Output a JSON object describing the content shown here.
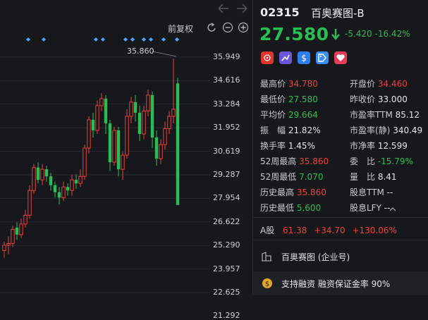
{
  "chart": {
    "restoration_label": "前复权",
    "y_ticks": [
      "35.949",
      "34.616",
      "33.284",
      "31.952",
      "30.619",
      "29.287",
      "27.954",
      "26.622",
      "25.290",
      "23.957",
      "22.625",
      "21.292"
    ],
    "peak_label": "35.860",
    "colors": {
      "up": "#ee3f3f",
      "down": "#2bbd55",
      "marker": "#4da3ff"
    }
  },
  "quote": {
    "code": "02315",
    "name": "百奥赛图-B",
    "price": "27.580",
    "change": "-5.420",
    "change_pct": "-16.42%",
    "stats": {
      "high_label": "最高价",
      "high": "34.780",
      "open_label": "开盘价",
      "open": "34.460",
      "low_label": "最低价",
      "low": "27.580",
      "prev_close_label": "昨收价",
      "prev_close": "33.000",
      "avg_label": "平均价",
      "avg": "29.664",
      "pe_ttm_label": "市盈率TTM",
      "pe_ttm": "85.12",
      "amplitude_label": "振　幅",
      "amplitude": "21.82%",
      "pe_static_label": "市盈率(静)",
      "pe_static": "340.49",
      "turnover_label": "换手率",
      "turnover": "1.45%",
      "pb_label": "市净率",
      "pb": "12.599",
      "w52_high_label": "52周最高",
      "w52_high": "35.860",
      "commission_label": "委　比",
      "commission": "-15.79%",
      "w52_low_label": "52周最低",
      "w52_low": "7.070",
      "volume_ratio_label": "量　比",
      "volume_ratio": "8.41",
      "hist_high_label": "历史最高",
      "hist_high": "35.860",
      "div_ttm_label": "股息TTM",
      "div_ttm": "--",
      "hist_low_label": "历史最低",
      "hist_low": "5.600",
      "div_lfy_label": "股息LFY",
      "div_lfy": "--"
    },
    "a_share": {
      "label": "A股",
      "price": "61.38",
      "change": "+34.70",
      "change_pct": "+130.06%"
    },
    "corp_account": "百奥赛图 (企业号)",
    "margin": {
      "text1": "支持融资",
      "text2": "融资保证金率 90%"
    }
  }
}
